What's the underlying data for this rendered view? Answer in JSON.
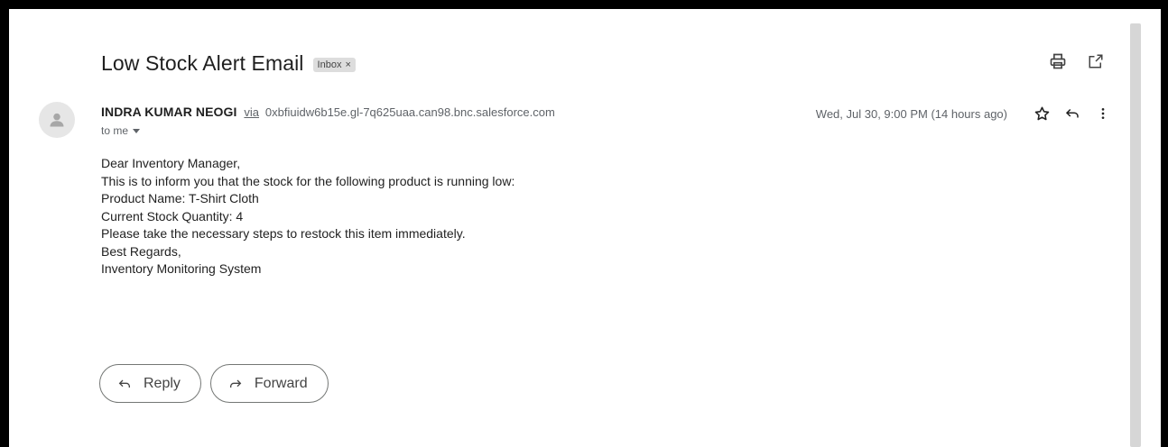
{
  "email": {
    "subject": "Low Stock Alert Email",
    "label": "Inbox",
    "label_remove": "×",
    "sender_name": "INDRA KUMAR NEOGI",
    "via": "via",
    "sender_address": "0xbfiuidw6b15e.gl-7q625uaa.can98.bnc.salesforce.com",
    "recipient": "to me",
    "date": "Wed, Jul 30, 9:00 PM (14 hours ago)",
    "body": {
      "line1": "Dear Inventory Manager,",
      "line2": "This is to inform you that the stock for the following product is running low:",
      "line3": "Product Name: T-Shirt Cloth",
      "line4": "Current Stock Quantity: 4",
      "line5": "Please take the necessary steps to restock this item immediately.",
      "line6": "Best Regards,",
      "line7": "Inventory Monitoring System"
    }
  },
  "actions": {
    "reply_label": "Reply",
    "forward_label": "Forward"
  },
  "icons": {
    "print": "print-icon",
    "open_new": "open-in-new-window-icon",
    "avatar": "person-icon",
    "star": "star-icon",
    "reply": "reply-icon",
    "more": "more-vertical-icon",
    "dropdown": "caret-down-icon",
    "forward": "forward-icon"
  },
  "colors": {
    "text": "#1f1f1f",
    "muted": "#5f6368",
    "chip_bg": "#dddddd",
    "frame": "#000000"
  }
}
